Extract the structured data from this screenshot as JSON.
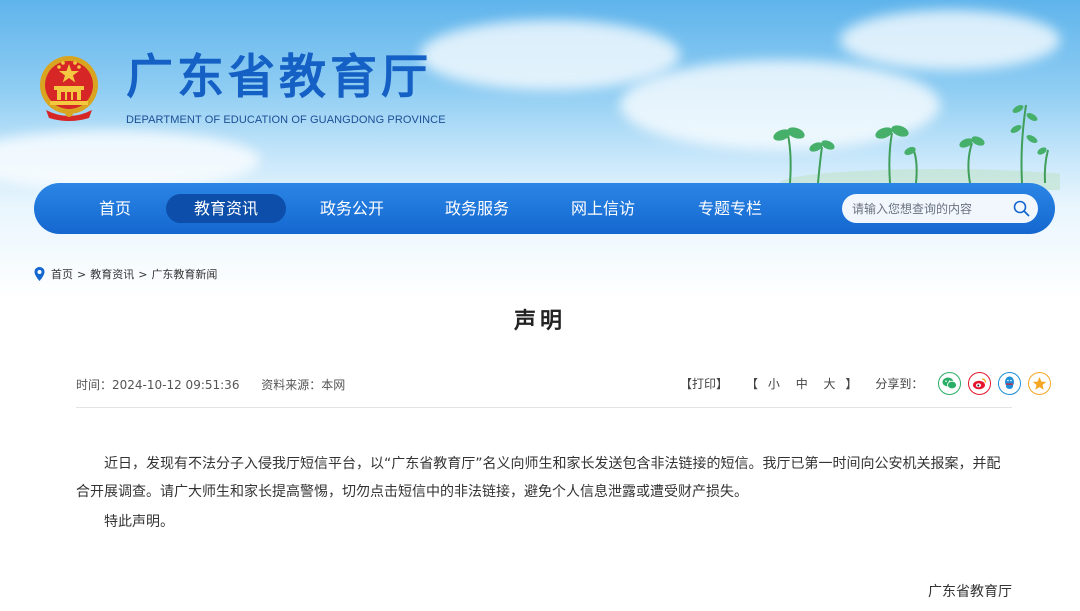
{
  "site": {
    "title": "广东省教育厅",
    "subtitle": "DEPARTMENT OF EDUCATION OF GUANGDONG PROVINCE"
  },
  "nav": {
    "items": [
      {
        "label": "首页",
        "active": false
      },
      {
        "label": "教育资讯",
        "active": true
      },
      {
        "label": "政务公开",
        "active": false
      },
      {
        "label": "政务服务",
        "active": false
      },
      {
        "label": "网上信访",
        "active": false
      },
      {
        "label": "专题专栏",
        "active": false
      }
    ],
    "search_placeholder": "请输入您想查询的内容"
  },
  "breadcrumb": {
    "items": [
      "首页",
      "教育资讯",
      "广东教育新闻"
    ],
    "separator": ">"
  },
  "article": {
    "title": "声明",
    "time": "时间：2024-10-12 09:51:36",
    "source": "资料来源：本网",
    "print_label": "【打印】",
    "size_open": "【",
    "size_small": "小",
    "size_medium": "中",
    "size_large": "大",
    "size_close": "】",
    "share_label": "分享到：",
    "share_icons": [
      "wechat-icon",
      "weibo-icon",
      "qq-icon",
      "qzone-icon"
    ],
    "paragraphs": [
      "近日，发现有不法分子入侵我厅短信平台，以“广东省教育厅”名义向师生和家长发送包含非法链接的短信。我厅已第一时间向公安机关报案，并配合开展调查。请广大师生和家长提高警惕，切勿点击短信中的非法链接，避免个人信息泄露或遭受财产损失。",
      "特此声明。"
    ],
    "signature": "广东省教育厅"
  },
  "colors": {
    "brand_blue": "#1560c4",
    "nav_blue": "#1467cf",
    "nav_active": "#0c4ea9",
    "wechat": "#2aae67",
    "weibo": "#e6162d",
    "qq": "#1e90d8",
    "qzone": "#f5a623"
  }
}
